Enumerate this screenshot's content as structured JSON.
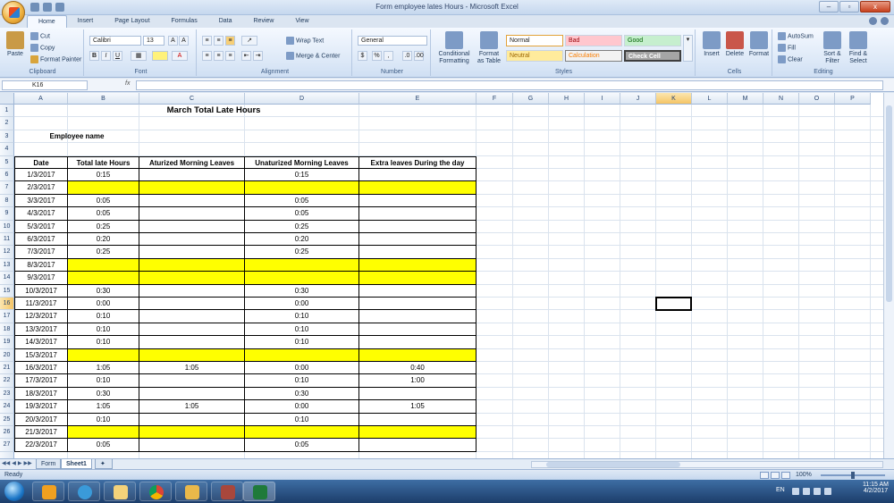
{
  "window": {
    "title": "Form employee lates Hours - Microsoft Excel",
    "controls": [
      "–",
      "▫",
      "x"
    ]
  },
  "ribbon_tabs": [
    "Home",
    "Insert",
    "Page Layout",
    "Formulas",
    "Data",
    "Review",
    "View"
  ],
  "ribbon": {
    "clipboard": {
      "paste": "Paste",
      "cut": "Cut",
      "copy": "Copy",
      "format_painter": "Format Painter",
      "label": "Clipboard"
    },
    "font": {
      "name": "Calibri",
      "size": "13",
      "bold": "B",
      "italic": "I",
      "underline": "U",
      "label": "Font"
    },
    "alignment": {
      "wrap_text": "Wrap Text",
      "merge_center": "Merge & Center",
      "label": "Alignment"
    },
    "number": {
      "format": "General",
      "currency": "$",
      "percent": "%",
      "comma": ",",
      "label": "Number"
    },
    "styles": {
      "conditional": "Conditional Formatting",
      "format_table": "Format as Table",
      "normal": "Normal",
      "bad": "Bad",
      "good": "Good",
      "neutral": "Neutral",
      "calculation": "Calculation",
      "check_cell": "Check Cell",
      "label": "Styles"
    },
    "cells": {
      "insert": "Insert",
      "delete": "Delete",
      "format": "Format",
      "label": "Cells"
    },
    "editing": {
      "autosum": "AutoSum",
      "fill": "Fill",
      "clear": "Clear",
      "sort": "Sort & Filter",
      "find": "Find & Select",
      "label": "Editing"
    }
  },
  "formula_bar": {
    "name_box": "K16",
    "fx": "fx",
    "content": ""
  },
  "columns": [
    "A",
    "B",
    "C",
    "D",
    "E",
    "F",
    "G",
    "H",
    "I",
    "J",
    "K",
    "L",
    "M",
    "N",
    "O",
    "P"
  ],
  "sheet": {
    "title": "March Total Late Hours",
    "employee_label": "Employee name",
    "headers": [
      "Date",
      "Total late  Hours",
      "Aturized Morning Leaves",
      "Unaturized Morning Leaves",
      "Extra leaves During the day"
    ],
    "rows": [
      {
        "row": "6",
        "date": "1/3/2017",
        "total": "0:15",
        "aturized": "",
        "unaturized": "0:15",
        "extra": "",
        "highlight": false
      },
      {
        "row": "7",
        "date": "2/3/2017",
        "total": "",
        "aturized": "",
        "unaturized": "",
        "extra": "",
        "highlight": true
      },
      {
        "row": "8",
        "date": "3/3/2017",
        "total": "0:05",
        "aturized": "",
        "unaturized": "0:05",
        "extra": "",
        "highlight": false
      },
      {
        "row": "9",
        "date": "4/3/2017",
        "total": "0:05",
        "aturized": "",
        "unaturized": "0:05",
        "extra": "",
        "highlight": false
      },
      {
        "row": "10",
        "date": "5/3/2017",
        "total": "0:25",
        "aturized": "",
        "unaturized": "0:25",
        "extra": "",
        "highlight": false
      },
      {
        "row": "11",
        "date": "6/3/2017",
        "total": "0:20",
        "aturized": "",
        "unaturized": "0:20",
        "extra": "",
        "highlight": false
      },
      {
        "row": "12",
        "date": "7/3/2017",
        "total": "0:25",
        "aturized": "",
        "unaturized": "0:25",
        "extra": "",
        "highlight": false
      },
      {
        "row": "13",
        "date": "8/3/2017",
        "total": "",
        "aturized": "",
        "unaturized": "",
        "extra": "",
        "highlight": true
      },
      {
        "row": "14",
        "date": "9/3/2017",
        "total": "",
        "aturized": "",
        "unaturized": "",
        "extra": "",
        "highlight": true
      },
      {
        "row": "15",
        "date": "10/3/2017",
        "total": "0:30",
        "aturized": "",
        "unaturized": "0:30",
        "extra": "",
        "highlight": false
      },
      {
        "row": "16",
        "date": "11/3/2017",
        "total": "0:00",
        "aturized": "",
        "unaturized": "0:00",
        "extra": "",
        "highlight": false
      },
      {
        "row": "17",
        "date": "12/3/2017",
        "total": "0:10",
        "aturized": "",
        "unaturized": "0:10",
        "extra": "",
        "highlight": false
      },
      {
        "row": "18",
        "date": "13/3/2017",
        "total": "0:10",
        "aturized": "",
        "unaturized": "0:10",
        "extra": "",
        "highlight": false
      },
      {
        "row": "19",
        "date": "14/3/2017",
        "total": "0:10",
        "aturized": "",
        "unaturized": "0:10",
        "extra": "",
        "highlight": false
      },
      {
        "row": "20",
        "date": "15/3/2017",
        "total": "",
        "aturized": "",
        "unaturized": "",
        "extra": "",
        "highlight": true
      },
      {
        "row": "21",
        "date": "16/3/2017",
        "total": "1:05",
        "aturized": "1:05",
        "unaturized": "0:00",
        "extra": "0:40",
        "highlight": false
      },
      {
        "row": "22",
        "date": "17/3/2017",
        "total": "0:10",
        "aturized": "",
        "unaturized": "0:10",
        "extra": "1:00",
        "highlight": false
      },
      {
        "row": "23",
        "date": "18/3/2017",
        "total": "0:30",
        "aturized": "",
        "unaturized": "0:30",
        "extra": "",
        "highlight": false
      },
      {
        "row": "24",
        "date": "19/3/2017",
        "total": "1:05",
        "aturized": "1:05",
        "unaturized": "0:00",
        "extra": "1:05",
        "highlight": false
      },
      {
        "row": "25",
        "date": "20/3/2017",
        "total": "0:10",
        "aturized": "",
        "unaturized": "0:10",
        "extra": "",
        "highlight": false
      },
      {
        "row": "26",
        "date": "21/3/2017",
        "total": "",
        "aturized": "",
        "unaturized": "",
        "extra": "",
        "highlight": true
      },
      {
        "row": "27",
        "date": "22/3/2017",
        "total": "0:05",
        "aturized": "",
        "unaturized": "0:05",
        "extra": "",
        "highlight": false
      }
    ]
  },
  "sheet_tabs": [
    "Form",
    "Sheet1"
  ],
  "status": {
    "ready": "Ready",
    "zoom": "100%"
  },
  "taskbar": {
    "lang": "EN",
    "time": "11:15 AM",
    "date": "4/2/2017"
  },
  "colors": {
    "highlight": "#ffff00",
    "selection": "#f5c565",
    "ribbon": "#dce8f7"
  }
}
